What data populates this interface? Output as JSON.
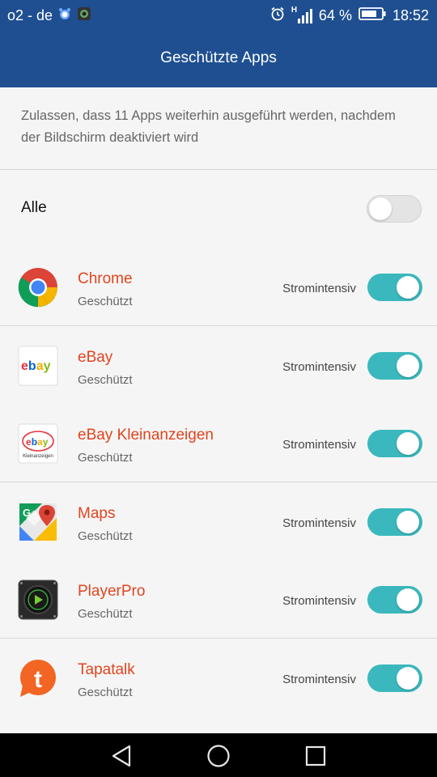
{
  "status_bar": {
    "carrier": "o2 - de",
    "battery_percent": "64 %",
    "time": "18:52",
    "network_type": "H"
  },
  "header": {
    "title": "Geschützte Apps"
  },
  "description": "Zulassen, dass 11 Apps weiterhin ausgeführt werden, nachdem der Bildschirm deaktiviert wird",
  "all_toggle": {
    "label": "Alle",
    "on": false
  },
  "apps": [
    {
      "name": "Chrome",
      "status": "Geschützt",
      "tag": "Stromintensiv",
      "on": true,
      "icon": "chrome-icon"
    },
    {
      "name": "eBay",
      "status": "Geschützt",
      "tag": "Stromintensiv",
      "on": true,
      "icon": "ebay-icon"
    },
    {
      "name": "eBay Kleinanzeigen",
      "status": "Geschützt",
      "tag": "Stromintensiv",
      "on": true,
      "icon": "ebay-kleinanzeigen-icon",
      "icon_text": "Kleinanzeigen"
    },
    {
      "name": "Maps",
      "status": "Geschützt",
      "tag": "Stromintensiv",
      "on": true,
      "icon": "maps-icon"
    },
    {
      "name": "PlayerPro",
      "status": "Geschützt",
      "tag": "Stromintensiv",
      "on": true,
      "icon": "playerpro-icon"
    },
    {
      "name": "Tapatalk",
      "status": "Geschützt",
      "tag": "Stromintensiv",
      "on": true,
      "icon": "tapatalk-icon"
    }
  ],
  "colors": {
    "header_bg": "#1f4f91",
    "app_name": "#e0451f",
    "toggle_on": "#3ab8bd"
  }
}
